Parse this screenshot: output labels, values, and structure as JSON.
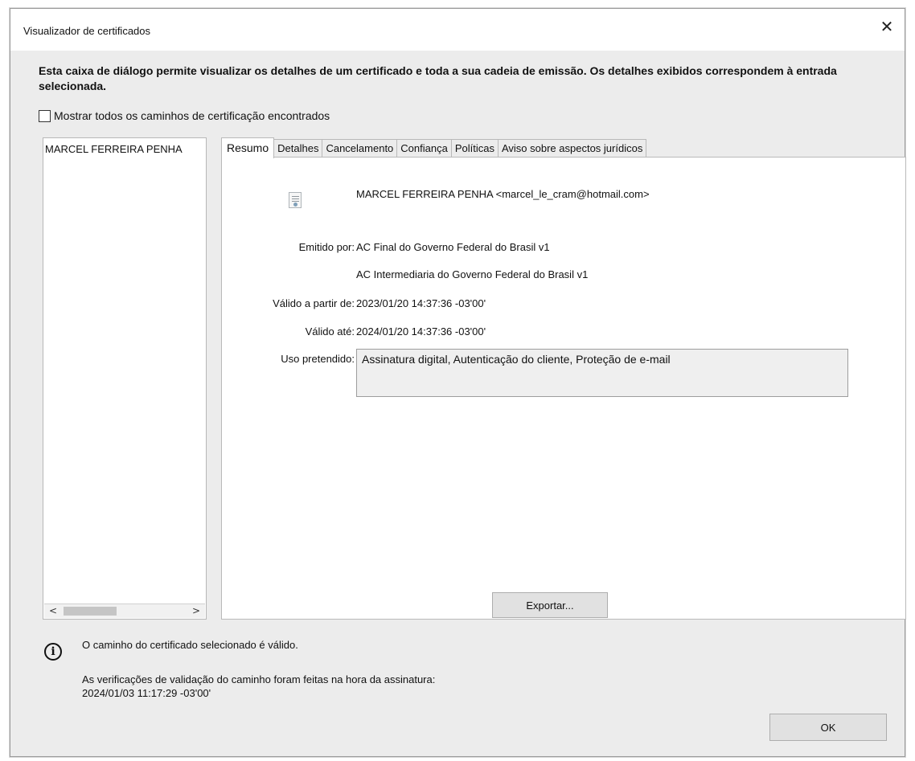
{
  "window": {
    "title": "Visualizador de certificados",
    "close_glyph": "✕"
  },
  "intro_text": "Esta caixa de diálogo permite visualizar os detalhes de um certificado e toda a sua cadeia de emissão. Os detalhes exibidos correspondem à entrada selecionada.",
  "show_all_paths": {
    "label": "Mostrar todos os caminhos de certificação encontrados",
    "checked": false
  },
  "certificate_tree": {
    "items": [
      {
        "label": "MARCEL FERREIRA PENHA"
      }
    ],
    "scroll_left_glyph": "<",
    "scroll_right_glyph": ">"
  },
  "tabs": [
    {
      "label": "Resumo",
      "active": true
    },
    {
      "label": "Detalhes",
      "active": false
    },
    {
      "label": "Cancelamento",
      "active": false
    },
    {
      "label": "Confiança",
      "active": false
    },
    {
      "label": "Políticas",
      "active": false
    },
    {
      "label": "Aviso sobre aspectos jurídicos",
      "active": false
    }
  ],
  "summary": {
    "subject": "MARCEL FERREIRA PENHA <marcel_le_cram@hotmail.com>",
    "issued_by_label": "Emitido por:",
    "issued_by_line1": "AC Final do Governo Federal do Brasil v1",
    "issued_by_line2": "AC Intermediaria do Governo Federal do Brasil v1",
    "valid_from_label": "Válido a partir de:",
    "valid_from": "2023/01/20 14:37:36 -03'00'",
    "valid_to_label": "Válido até:",
    "valid_to": "2024/01/20 14:37:36 -03'00'",
    "intended_use_label": "Uso pretendido:",
    "intended_use": "Assinatura digital, Autenticação do cliente, Proteção de e-mail",
    "export_label": "Exportar..."
  },
  "status": {
    "icon": "info-icon",
    "message": "O caminho do certificado selecionado é válido.",
    "verification_line1": "As verificações de validação do caminho foram feitas na hora da assinatura:",
    "verification_line2": "2024/01/03 11:17:29 -03'00'"
  },
  "ok_label": "OK"
}
